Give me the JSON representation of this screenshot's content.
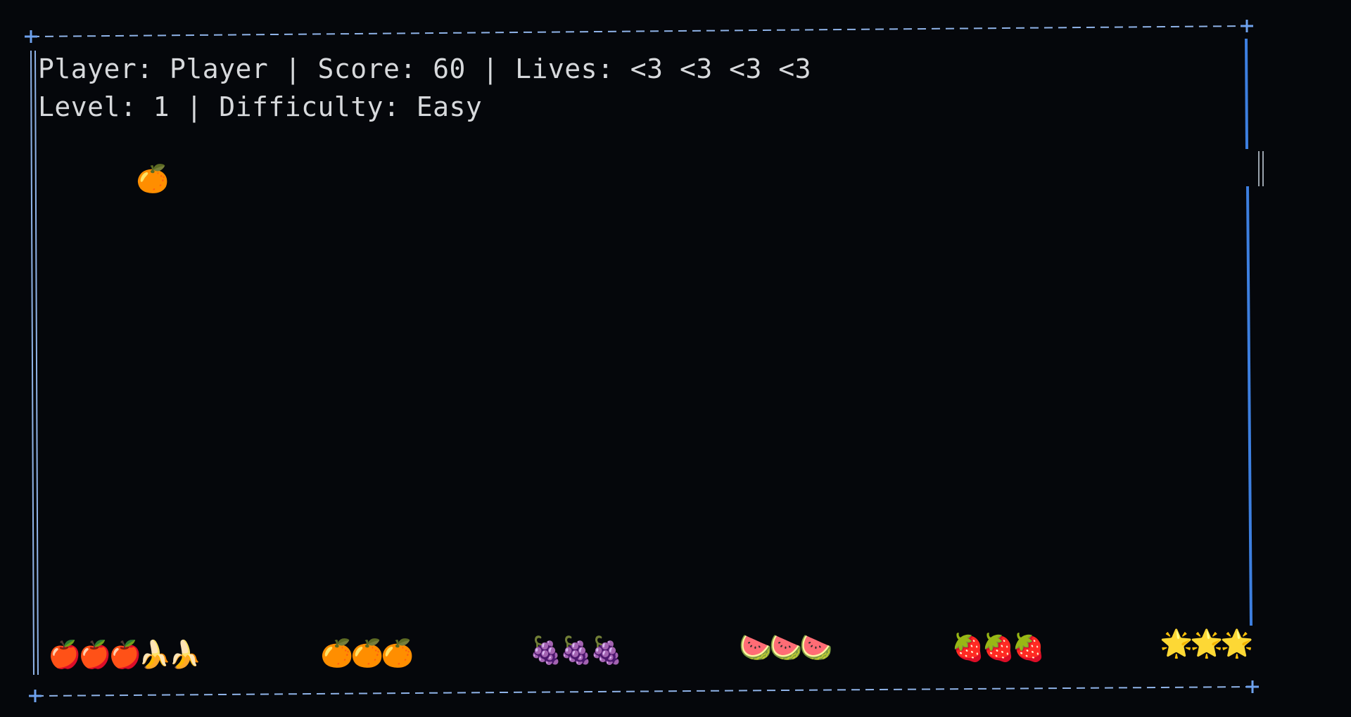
{
  "hud": {
    "player_label": "Player:",
    "player_name": "Player",
    "score_label": "Score:",
    "score": "60",
    "lives_label": "Lives:",
    "lives": [
      "<3",
      "<3",
      "<3",
      "<3"
    ],
    "separator": "|",
    "level_label": "Level:",
    "level": "1",
    "difficulty_label": "Difficulty:",
    "difficulty": "Easy"
  },
  "falling_item": {
    "icon": "orange-icon",
    "glyph": "🍊"
  },
  "caught_groups": [
    {
      "name": "apples",
      "icon": "apple-icon",
      "glyph": "🍎",
      "count": 3
    },
    {
      "name": "bananas",
      "icon": "banana-icon",
      "glyph": "🍌",
      "count": 2
    },
    {
      "name": "oranges",
      "icon": "orange-icon",
      "glyph": "🍊",
      "count": 3
    },
    {
      "name": "grapes",
      "icon": "grapes-icon",
      "glyph": "🍇",
      "count": 3
    },
    {
      "name": "watermelons",
      "icon": "watermelon-icon",
      "glyph": "🍉",
      "count": 3
    },
    {
      "name": "strawberries",
      "icon": "strawberry-icon",
      "glyph": "🍓",
      "count": 3
    },
    {
      "name": "stars",
      "icon": "star-icon",
      "glyph": "🌟",
      "count": 3
    }
  ],
  "colors": {
    "background": "#05070b",
    "border": "#8fb3e8",
    "border_bright": "#3d7fe0",
    "text": "#d7d9dc"
  }
}
